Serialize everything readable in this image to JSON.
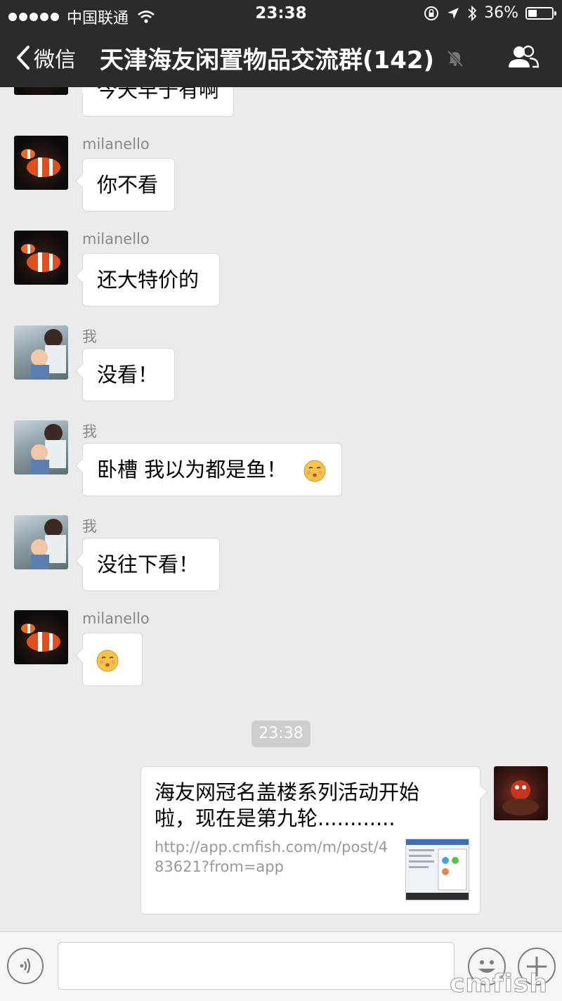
{
  "status_bar": {
    "carrier": "中国联通",
    "time": "23:38",
    "battery": "36%",
    "battery_level": 0.36
  },
  "nav": {
    "back_label": "微信",
    "title": "天津海友闲置物品交流群(142)"
  },
  "messages": [
    {
      "sender": "",
      "text": "今天早于有啊"
    },
    {
      "sender": "milanello",
      "text": "你不看"
    },
    {
      "sender": "milanello",
      "text": "还大特价的"
    },
    {
      "sender": "我",
      "text": "没看！"
    },
    {
      "sender": "我",
      "text": "卧槽 我以为都是鱼！"
    },
    {
      "sender": "我",
      "text": "没往下看！"
    },
    {
      "sender": "milanello",
      "text": ""
    }
  ],
  "timestamp_chip": "23:38",
  "link_card": {
    "title": "海友网冠名盖楼系列活动开始啦，现在是第九轮............",
    "url": "http://app.cmfish.com/m/post/483621?from=app"
  },
  "watermark": "cmfish"
}
